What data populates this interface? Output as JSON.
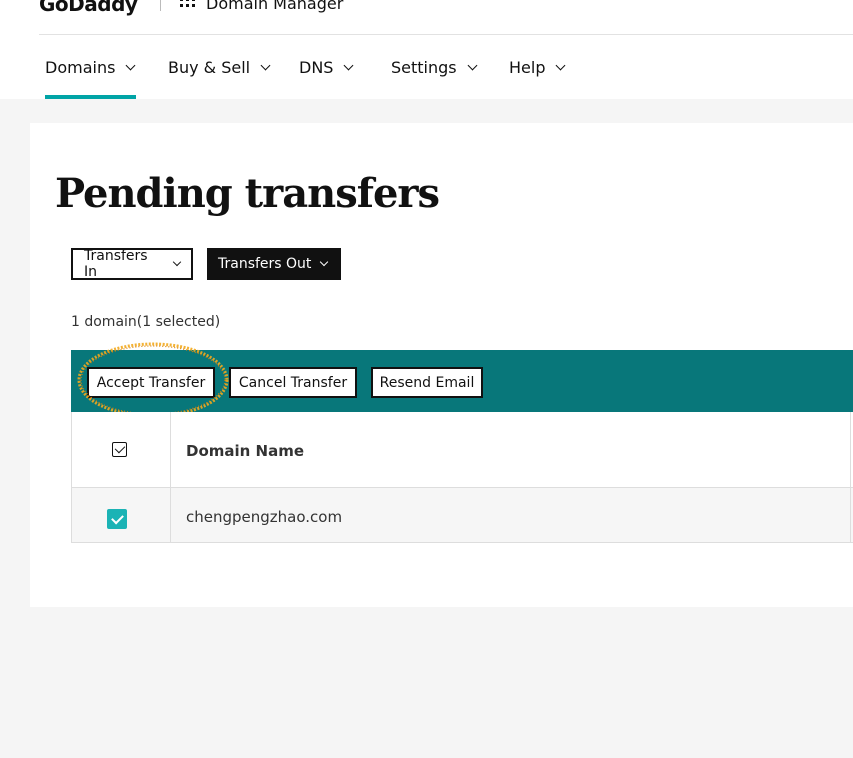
{
  "header": {
    "logo_text": "GoDaddy",
    "app_title": "Domain Manager",
    "app_icon": "grid-icon"
  },
  "nav": {
    "items": [
      {
        "label": "Domains",
        "active": true
      },
      {
        "label": "Buy & Sell"
      },
      {
        "label": "DNS"
      },
      {
        "label": "Settings"
      },
      {
        "label": "Help"
      }
    ],
    "active_color": "#00a4a6"
  },
  "page": {
    "title": "Pending transfers",
    "filters": {
      "transfers_in": "Transfers In",
      "transfers_out": "Transfers Out"
    },
    "count_text": "1 domain(1 selected)"
  },
  "actions": {
    "accept": "Accept Transfer",
    "cancel": "Cancel Transfer",
    "resend": "Resend Email",
    "bar_color": "#08777a"
  },
  "table": {
    "columns": [
      "Domain Name"
    ],
    "rows": [
      {
        "domain": "chengpengzhao.com",
        "selected": true
      }
    ]
  }
}
